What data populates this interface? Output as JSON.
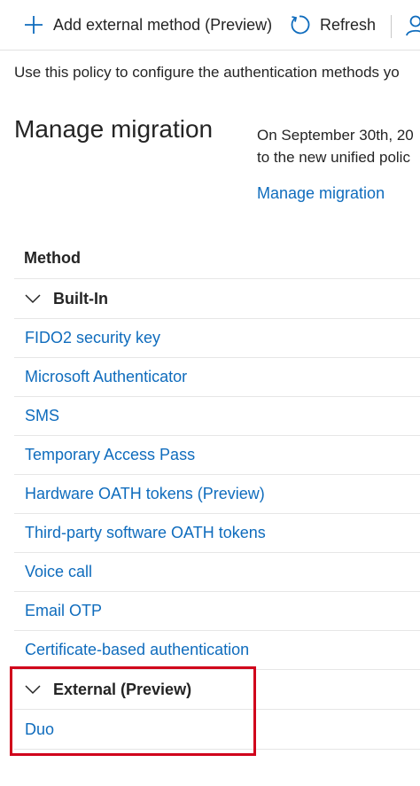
{
  "toolbar": {
    "add_label": "Add external method (Preview)",
    "refresh_label": "Refresh"
  },
  "description": "Use this policy to configure the authentication methods yo",
  "migration": {
    "title": "Manage migration",
    "text_line1": "On September 30th, 20",
    "text_line2": "to the new unified polic",
    "link": "Manage migration"
  },
  "table": {
    "header": "Method",
    "groups": [
      {
        "label": "Built-In",
        "items": [
          "FIDO2 security key",
          "Microsoft Authenticator",
          "SMS",
          "Temporary Access Pass",
          "Hardware OATH tokens (Preview)",
          "Third-party software OATH tokens",
          "Voice call",
          "Email OTP",
          "Certificate-based authentication"
        ]
      },
      {
        "label": "External (Preview)",
        "items": [
          "Duo"
        ]
      }
    ]
  },
  "colors": {
    "link": "#0f6cbd",
    "highlight": "#d0021b"
  },
  "icons": {
    "add": "plus-icon",
    "refresh": "refresh-icon",
    "more": "person-icon",
    "chevron": "chevron-down-icon"
  }
}
